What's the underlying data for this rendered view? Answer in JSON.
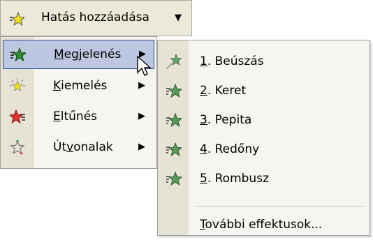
{
  "toolbar": {
    "add_effect_label": "Hatás hozzáadása",
    "dropdown_arrow": "▼",
    "star_icon": "star-icon"
  },
  "menu": {
    "items": [
      {
        "label_pre": "",
        "label_mnemonic": "M",
        "label_post": "egjelenés",
        "arrow": "▶",
        "icon": "star-green-icon",
        "active": true
      },
      {
        "label_pre": "",
        "label_mnemonic": "K",
        "label_post": "iemelés",
        "arrow": "▶",
        "icon": "star-yellow-icon",
        "active": false
      },
      {
        "label_pre": "",
        "label_mnemonic": "E",
        "label_post": "ltűnés",
        "arrow": "▶",
        "icon": "star-red-icon",
        "active": false
      },
      {
        "label_pre": "Út",
        "label_mnemonic": "v",
        "label_post": "onalak",
        "arrow": "▶",
        "icon": "star-outline-icon",
        "active": false
      }
    ]
  },
  "submenu": {
    "items": [
      {
        "mnemonic": "1",
        "label": ". Beúszás"
      },
      {
        "mnemonic": "2",
        "label": ". Keret"
      },
      {
        "mnemonic": "3",
        "label": ". Pepita"
      },
      {
        "mnemonic": "4",
        "label": ". Redőny"
      },
      {
        "mnemonic": "5",
        "label": ". Rombusz"
      }
    ],
    "more": {
      "mnemonic": "T",
      "label": "ovábbi effektusok..."
    }
  },
  "colors": {
    "menu_bg": "#f6f5f0",
    "gutter": "#e6e3d5",
    "highlight": "#bdc7e1",
    "highlight_border": "#2b4c8e",
    "green_star": "#2e8b2e",
    "yellow_star": "#f2e01a",
    "red_star": "#e03030"
  }
}
